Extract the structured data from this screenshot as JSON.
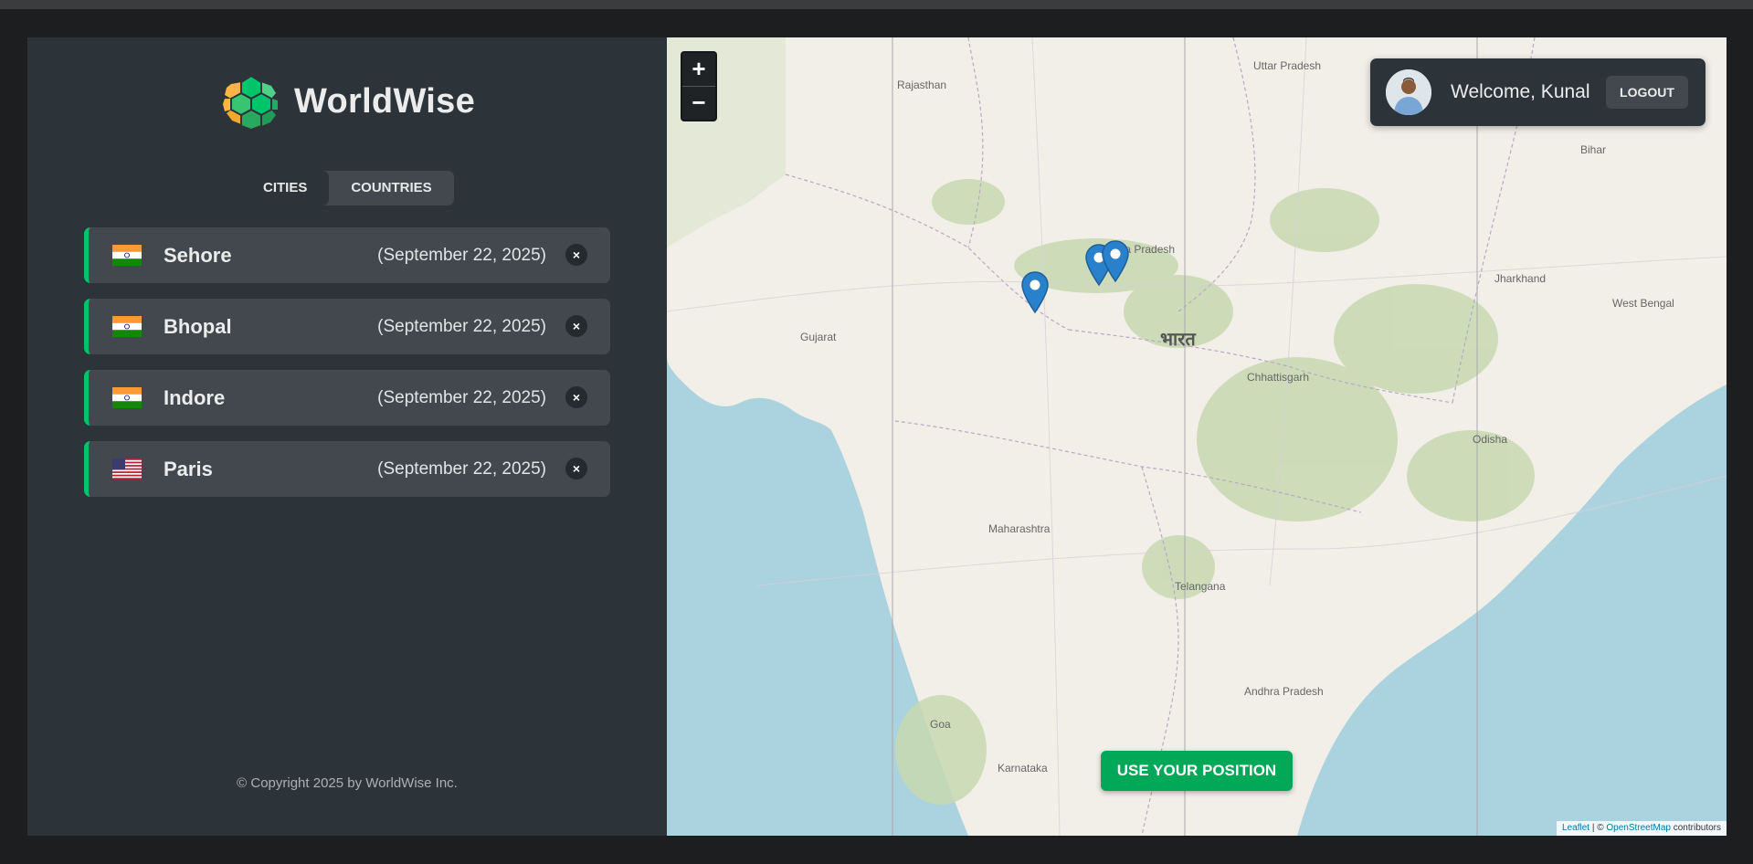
{
  "app": {
    "name": "WorldWise",
    "copyright": "© Copyright 2025 by WorldWise Inc."
  },
  "tabs": [
    {
      "label": "Cities",
      "active": true
    },
    {
      "label": "Countries",
      "active": false
    }
  ],
  "cities": [
    {
      "name": "Sehore",
      "date": "(September 22, 2025)",
      "flag": "india-flag",
      "delete": "×"
    },
    {
      "name": "Bhopal",
      "date": "(September 22, 2025)",
      "flag": "india-flag",
      "delete": "×"
    },
    {
      "name": "Indore",
      "date": "(September 22, 2025)",
      "flag": "india-flag",
      "delete": "×"
    },
    {
      "name": "Paris",
      "date": "(September 22, 2025)",
      "flag": "usa-flag",
      "delete": "×"
    }
  ],
  "map": {
    "zoom_in": "+",
    "zoom_out": "−",
    "welcome": "Welcome, Kunal",
    "logout": "Logout",
    "use_position": "Use your position",
    "attribution_leaflet": "Leaflet",
    "attribution_sep": " | © ",
    "attribution_osm": "OpenStreetMap",
    "attribution_rest": " contributors",
    "labels": {
      "rajasthan": "Rajasthan",
      "uttar_pradesh": "Uttar Pradesh",
      "bihar": "Bihar",
      "gujarat": "Gujarat",
      "madhya_pradesh": "dhya Pradesh",
      "bharat": "भारत",
      "jharkhand": "Jharkhand",
      "west_bengal": "West Bengal",
      "chhattisgarh": "Chhattisgarh",
      "odisha": "Odisha",
      "maharashtra": "Maharashtra",
      "telangana": "Telangana",
      "andhra_pradesh": "Andhra Pradesh",
      "goa": "Goa",
      "karnataka": "Karnataka"
    }
  },
  "colors": {
    "accent": "#00c46a",
    "button_green": "#00a857",
    "sidebar_bg": "#2d3439",
    "item_bg": "#42484d",
    "map_water": "#aad3df",
    "map_land": "#f2efe9",
    "marker": "#2a81cb"
  }
}
